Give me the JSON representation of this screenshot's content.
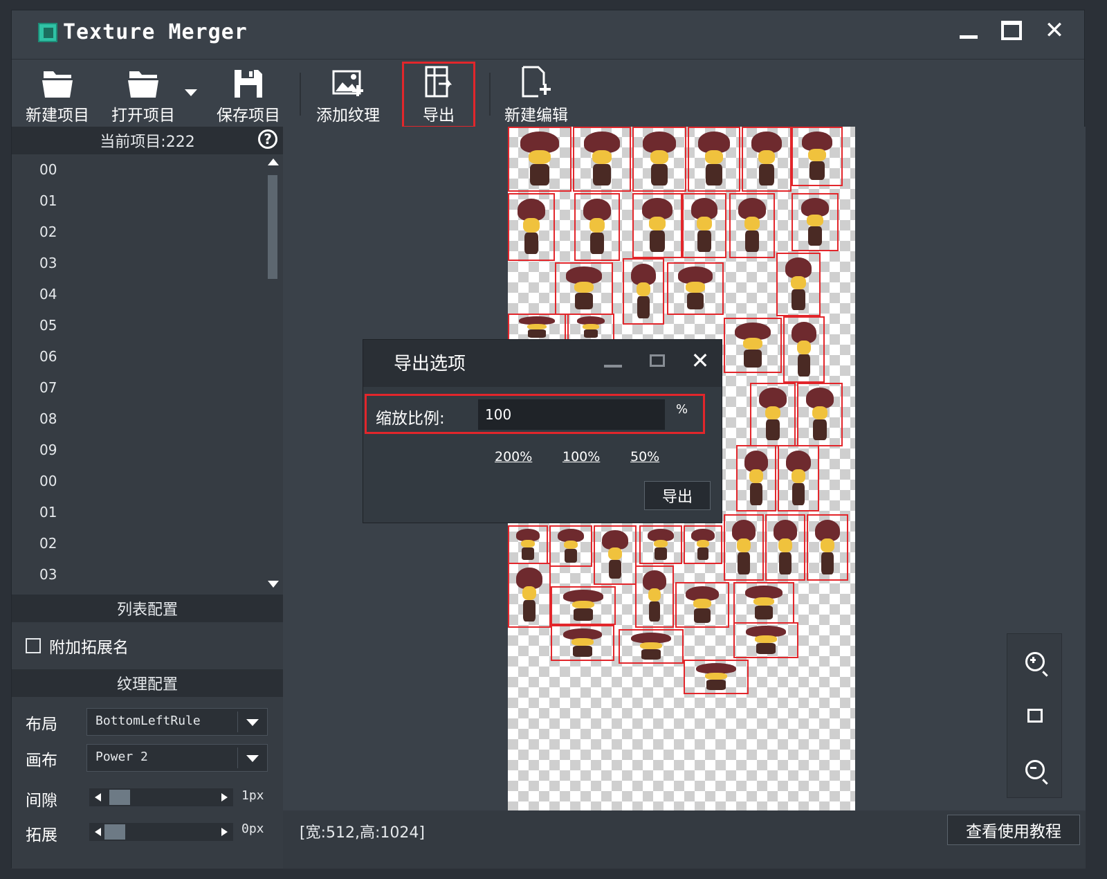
{
  "window": {
    "title": "Texture Merger",
    "icons": {
      "logo": "texture-merger-logo",
      "minimize": "minimize-icon",
      "maximize": "maximize-icon",
      "close": "close-icon"
    }
  },
  "toolbar": {
    "new_project": "新建项目",
    "open_project": "打开项目",
    "save_project": "保存项目",
    "add_texture": "添加纹理",
    "export": "导出",
    "new_edit": "新建编辑"
  },
  "project": {
    "current_label": "当前项目:222",
    "items": [
      "00",
      "01",
      "02",
      "03",
      "04",
      "05",
      "06",
      "07",
      "08",
      "09",
      "00",
      "01",
      "02",
      "03"
    ]
  },
  "list_config": {
    "header": "列表配置",
    "append_extension_label": "附加拓展名",
    "append_extension_checked": false
  },
  "texture_config": {
    "header": "纹理配置",
    "layout_label": "布局",
    "layout_value": "BottomLeftRule",
    "canvas_label": "画布",
    "canvas_value": "Power 2",
    "gap_label": "间隙",
    "gap_value": "1px",
    "gap_level": 0.05,
    "extend_label": "拓展",
    "extend_value": "0px",
    "extend_level": 0.0
  },
  "status": {
    "size_text": "[宽:512,高:1024]",
    "tutorial_button": "查看使用教程"
  },
  "export_dialog": {
    "title": "导出选项",
    "scale_label": "缩放比例:",
    "scale_value": "100",
    "scale_unit": "%",
    "presets": [
      "200%",
      "100%",
      "50%"
    ],
    "export_button": "导出"
  },
  "colors": {
    "highlight_red": "#e2262b",
    "sprite_hat": "#6e2a2e",
    "sprite_hair": "#f0c23d",
    "app_bg": "#3a4149",
    "panel_bg": "#363c43"
  }
}
